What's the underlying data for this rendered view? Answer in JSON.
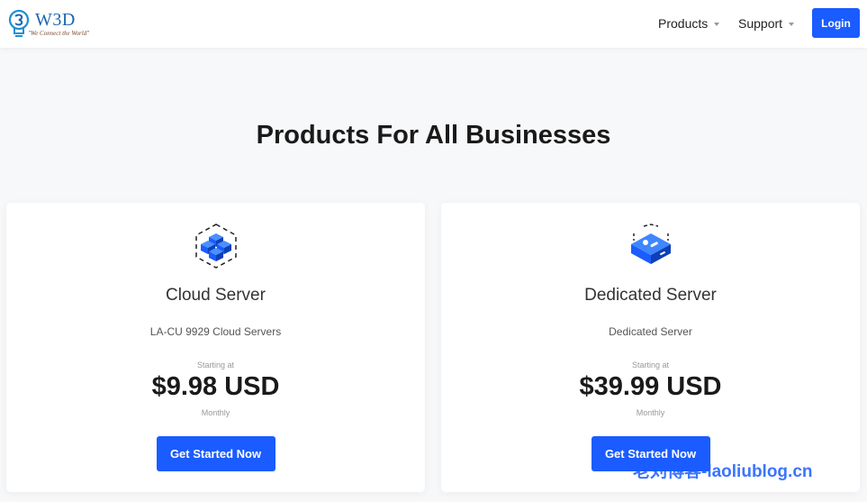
{
  "header": {
    "logo_text": "W3D",
    "logo_tagline": "\"We Connect the World\"",
    "nav": [
      {
        "label": "Products"
      },
      {
        "label": "Support"
      }
    ],
    "login_label": "Login"
  },
  "main": {
    "title": "Products For All Businesses",
    "products": [
      {
        "name": "Cloud Server",
        "description": "LA-CU 9929 Cloud Servers",
        "starting_label": "Starting at",
        "price": "$9.98 USD",
        "period": "Monthly",
        "cta_label": "Get Started Now",
        "icon": "cloud-cubes-icon"
      },
      {
        "name": "Dedicated Server",
        "description": "Dedicated Server",
        "starting_label": "Starting at",
        "price": "$39.99 USD",
        "period": "Monthly",
        "cta_label": "Get Started Now",
        "icon": "server-box-icon"
      }
    ]
  },
  "watermark": "老刘博客-laoliublog.cn",
  "colors": {
    "accent": "#1a5cff",
    "logo_blue": "#1b67b0"
  }
}
